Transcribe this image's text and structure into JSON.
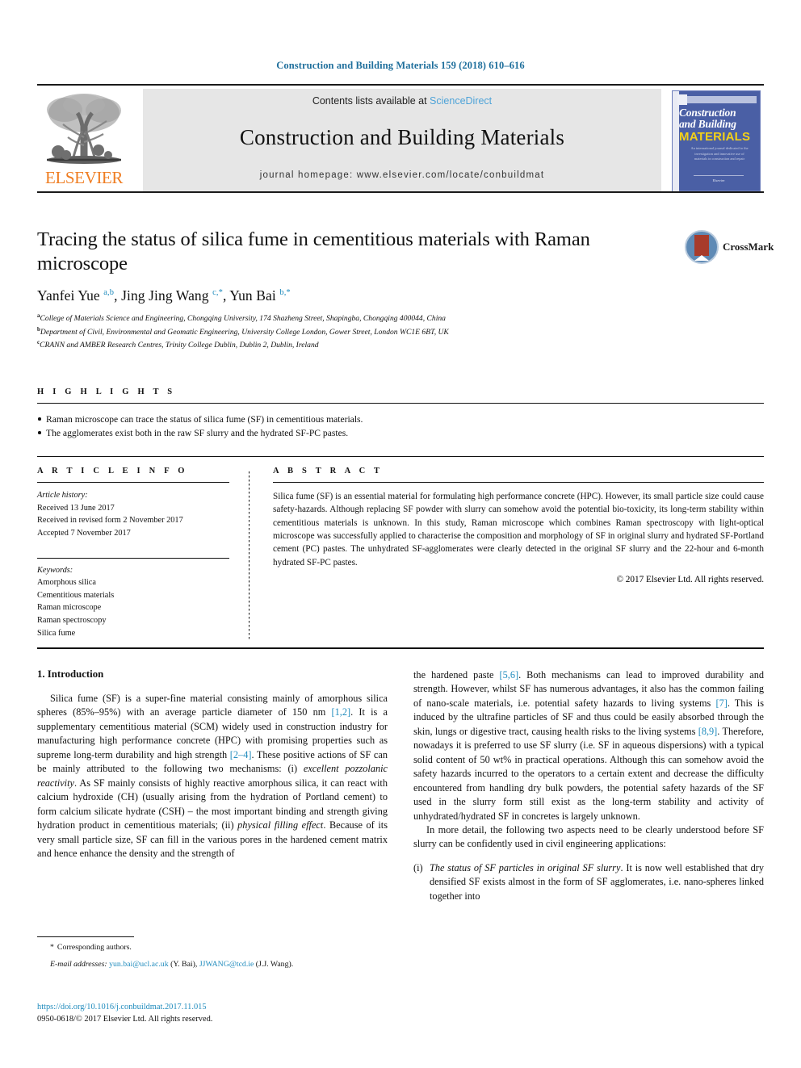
{
  "running_head": "Construction and Building Materials 159 (2018) 610–616",
  "masthead": {
    "publisher_name": "ELSEVIER",
    "contents_line_prefix": "Contents lists available at ",
    "contents_line_link": "ScienceDirect",
    "journal_title": "Construction and Building Materials",
    "journal_homepage": "journal homepage: www.elsevier.com/locate/conbuildmat",
    "cover": {
      "line1": "Construction",
      "line2": "and Building",
      "line3": "MATERIALS",
      "blurb": "An international journal dedicated to the investigation and innovative use of materials in construction and repair",
      "footer": "Elsevier"
    }
  },
  "article": {
    "title": "Tracing the status of silica fume in cementitious materials with Raman microscope",
    "crossmark_label": "CrossMark",
    "authors_html": "Yanfei Yue <sup>a,b</sup>, Jing Jing Wang <sup>c,</sup><sup>*</sup>, Yun Bai <sup>b,</sup><sup>*</sup>",
    "affiliations": [
      {
        "mark": "a",
        "text": "College of Materials Science and Engineering, Chongqing University, 174 Shazheng Street, Shapingba, Chongqing 400044, China"
      },
      {
        "mark": "b",
        "text": "Department of Civil, Environmental and Geomatic Engineering, University College London, Gower Street, London WC1E 6BT, UK"
      },
      {
        "mark": "c",
        "text": "CRANN and AMBER Research Centres, Trinity College Dublin, Dublin 2, Dublin, Ireland"
      }
    ]
  },
  "highlights": {
    "label": "H I G H L I G H T S",
    "items": [
      "Raman microscope can trace the status of silica fume (SF) in cementitious materials.",
      "The agglomerates exist both in the raw SF slurry and the hydrated SF-PC pastes."
    ]
  },
  "article_info": {
    "label": "A R T I C L E   I N F O",
    "history_label": "Article history:",
    "history": [
      "Received 13 June 2017",
      "Received in revised form 2 November 2017",
      "Accepted 7 November 2017"
    ],
    "keywords_label": "Keywords:",
    "keywords": [
      "Amorphous silica",
      "Cementitious materials",
      "Raman microscope",
      "Raman spectroscopy",
      "Silica fume"
    ]
  },
  "abstract": {
    "label": "A B S T R A C T",
    "text": "Silica fume (SF) is an essential material for formulating high performance concrete (HPC). However, its small particle size could cause safety-hazards. Although replacing SF powder with slurry can somehow avoid the potential bio-toxicity, its long-term stability within cementitious materials is unknown. In this study, Raman microscope which combines Raman spectroscopy with light-optical microscope was successfully applied to characterise the composition and morphology of SF in original slurry and hydrated SF-Portland cement (PC) pastes. The unhydrated SF-agglomerates were clearly detected in the original SF slurry and the 22-hour and 6-month hydrated SF-PC pastes.",
    "copyright": "© 2017 Elsevier Ltd. All rights reserved."
  },
  "body": {
    "section_heading": "1. Introduction",
    "left_paragraph_1_html": "Silica fume (SF) is a super-fine material consisting mainly of amorphous silica spheres (85%–95%) with an average particle diameter of 150 nm <span class=\"ref\">[1,2]</span>. It is a supplementary cementitious material (SCM) widely used in construction industry for manufacturing high performance concrete (HPC) with promising properties such as supreme long-term durability and high strength <span class=\"ref\">[2–4]</span>. These positive actions of SF can be mainly attributed to the following two mechanisms: (i) <span class=\"it\">excellent pozzolanic reactivity</span>. As SF mainly consists of highly reactive amorphous silica, it can react with calcium hydroxide (CH) (usually arising from the hydration of Portland cement) to form calcium silicate hydrate (CSH) – the most important binding and strength giving hydration product in cementitious materials; (ii) <span class=\"it\">physical filling effect</span>. Because of its very small particle size, SF can fill in the various pores in the hardened cement matrix and hence enhance the density and the strength of",
    "right_paragraph_1_html": "the hardened paste <span class=\"ref\">[5,6]</span>. Both mechanisms can lead to improved durability and strength. However, whilst SF has numerous advantages, it also has the common failing of nano-scale materials, i.e. potential safety hazards to living systems <span class=\"ref\">[7]</span>. This is induced by the ultrafine particles of SF and thus could be easily absorbed through the skin, lungs or digestive tract, causing health risks to the living systems <span class=\"ref\">[8,9]</span>. Therefore, nowadays it is preferred to use SF slurry (i.e. SF in aqueous dispersions) with a typical solid content of 50 wt% in practical operations. Although this can somehow avoid the safety hazards incurred to the operators to a certain extent and decrease the difficulty encountered from handling dry bulk powders, the potential safety hazards of the SF used in the slurry form still exist as the long-term stability and activity of unhydrated/hydrated SF in concretes is largely unknown.",
    "right_paragraph_2_html": "In more detail, the following two aspects need to be clearly understood before SF slurry can be confidently used in civil engineering applications:",
    "right_list_item_mark": "(i)",
    "right_list_item_html": "<span class=\"it\">The status of SF particles in original SF slurry</span>. It is now well established that dry densified SF exists almost in the form of SF agglomerates, i.e. nano-spheres linked together into"
  },
  "footnote": {
    "corresponding_star": "*",
    "corresponding_text": "Corresponding authors.",
    "email_label": "E-mail addresses:",
    "email_1": "yun.bai@ucl.ac.uk",
    "email_1_owner": "(Y. Bai),",
    "email_2": "JJWANG@tcd.ie",
    "email_2_owner": "(J.J. Wang).",
    "doi": "https://doi.org/10.1016/j.conbuildmat.2017.11.015",
    "issn_line": "0950-0618/© 2017 Elsevier Ltd. All rights reserved."
  },
  "colors": {
    "link": "#1f8bbd",
    "running_head": "#1f6f9c",
    "elsevier_orange": "#ef7d22",
    "cover_blue": "#4a5fa5",
    "masthead_gray": "#e6e6e6"
  }
}
